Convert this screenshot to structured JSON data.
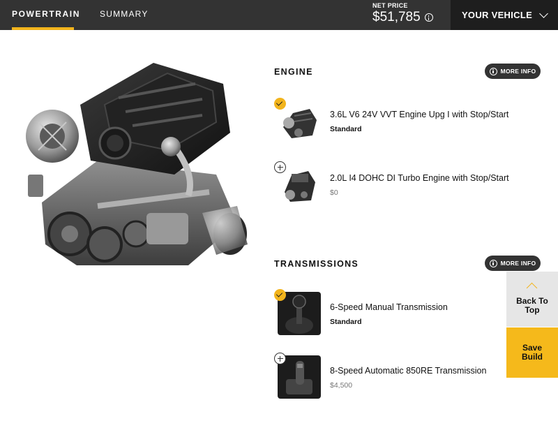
{
  "header": {
    "tabs": [
      {
        "label": "POWERTRAIN",
        "active": true
      },
      {
        "label": "SUMMARY",
        "active": false
      }
    ],
    "net_price_label": "NET PRICE",
    "net_price_value": "$51,785",
    "your_vehicle_label": "YOUR VEHICLE"
  },
  "sections": {
    "engine": {
      "title": "ENGINE",
      "more_info": "MORE INFO",
      "options": [
        {
          "name": "3.6L V6 24V VVT Engine Upg I with Stop/Start",
          "price": "Standard",
          "selected": true
        },
        {
          "name": "2.0L I4 DOHC DI Turbo Engine with Stop/Start",
          "price": "$0",
          "selected": false
        }
      ]
    },
    "transmissions": {
      "title": "TRANSMISSIONS",
      "more_info": "MORE INFO",
      "options": [
        {
          "name": "6-Speed Manual Transmission",
          "price": "Standard",
          "selected": true
        },
        {
          "name": "8-Speed Automatic 850RE Transmission",
          "price": "$4,500",
          "selected": false
        }
      ]
    }
  },
  "floating": {
    "back_to_top_line1": "Back To",
    "back_to_top_line2": "Top",
    "save_line1": "Save",
    "save_line2": "Build"
  },
  "colors": {
    "accent": "#f2b41c",
    "topbar": "#333333",
    "your_vehicle_bg": "#1e1e1e"
  }
}
